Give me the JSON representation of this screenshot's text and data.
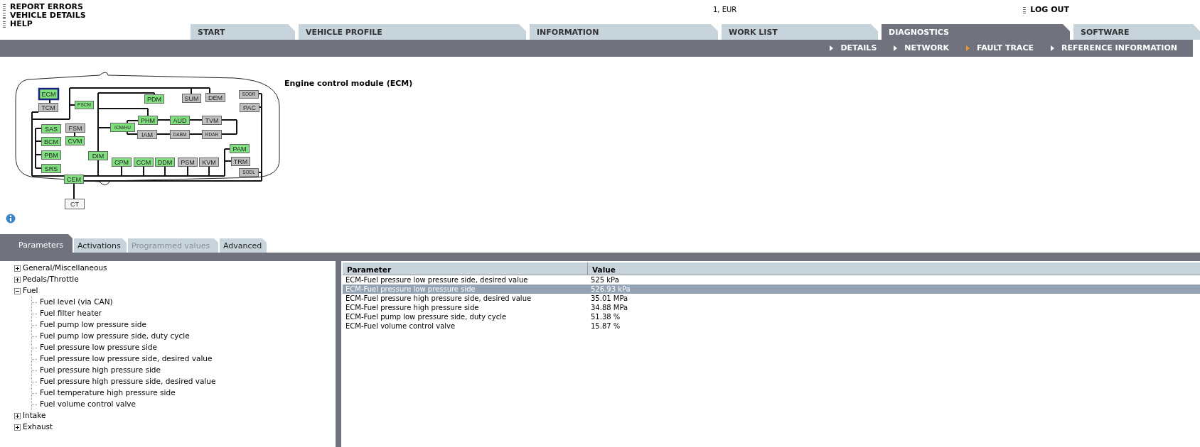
{
  "header_links": [
    {
      "label": "REPORT ERRORS"
    },
    {
      "label": "VEHICLE DETAILS"
    },
    {
      "label": "HELP"
    }
  ],
  "currency": "1, EUR",
  "logout": "LOG OUT",
  "tabs": [
    {
      "label": "START",
      "selected": false
    },
    {
      "label": "VEHICLE PROFILE",
      "selected": false
    },
    {
      "label": "INFORMATION",
      "selected": false
    },
    {
      "label": "WORK LIST",
      "selected": false
    },
    {
      "label": "DIAGNOSTICS",
      "selected": true
    },
    {
      "label": "SOFTWARE",
      "selected": false
    }
  ],
  "subnav": [
    {
      "label": "DETAILS",
      "selected": false
    },
    {
      "label": "NETWORK",
      "selected": false
    },
    {
      "label": "FAULT TRACE",
      "selected": true
    },
    {
      "label": "REFERENCE INFORMATION",
      "selected": false
    }
  ],
  "module_title": "Engine control module (ECM)",
  "network": {
    "modules": [
      {
        "label": "ECM",
        "color": "#80e080",
        "selected": true
      },
      {
        "label": "TCM",
        "color": "#c0c0c0",
        "selected": false
      },
      {
        "label": "PSCM",
        "color": "#80e080",
        "selected": false
      },
      {
        "label": "PDM",
        "color": "#80e080",
        "selected": false
      },
      {
        "label": "SUM",
        "color": "#c0c0c0",
        "selected": false
      },
      {
        "label": "DEM",
        "color": "#c0c0c0",
        "selected": false
      },
      {
        "label": "SODR",
        "color": "#c0c0c0",
        "selected": false
      },
      {
        "label": "PAC",
        "color": "#c0c0c0",
        "selected": false
      },
      {
        "label": "PHM",
        "color": "#80e080",
        "selected": false
      },
      {
        "label": "AUD",
        "color": "#80e080",
        "selected": false
      },
      {
        "label": "TVM",
        "color": "#c0c0c0",
        "selected": false
      },
      {
        "label": "ICM/HU",
        "color": "#80e080",
        "selected": false
      },
      {
        "label": "IAM",
        "color": "#c0c0c0",
        "selected": false
      },
      {
        "label": "DABM",
        "color": "#c0c0c0",
        "selected": false
      },
      {
        "label": "RDAR",
        "color": "#c0c0c0",
        "selected": false
      },
      {
        "label": "FSM",
        "color": "#c0c0c0",
        "selected": false
      },
      {
        "label": "CVM",
        "color": "#80e080",
        "selected": false
      },
      {
        "label": "SAS",
        "color": "#80e080",
        "selected": false
      },
      {
        "label": "BCM",
        "color": "#80e080",
        "selected": false
      },
      {
        "label": "PBM",
        "color": "#80e080",
        "selected": false
      },
      {
        "label": "SRS",
        "color": "#80e080",
        "selected": false
      },
      {
        "label": "DIM",
        "color": "#80e080",
        "selected": false
      },
      {
        "label": "CPM",
        "color": "#80e080",
        "selected": false
      },
      {
        "label": "CCM",
        "color": "#80e080",
        "selected": false
      },
      {
        "label": "DDM",
        "color": "#80e080",
        "selected": false
      },
      {
        "label": "PSM",
        "color": "#c0c0c0",
        "selected": false
      },
      {
        "label": "KVM",
        "color": "#c0c0c0",
        "selected": false
      },
      {
        "label": "PAM",
        "color": "#80e080",
        "selected": false
      },
      {
        "label": "TRM",
        "color": "#c0c0c0",
        "selected": false
      },
      {
        "label": "SODL",
        "color": "#c0c0c0",
        "selected": false
      },
      {
        "label": "CEM",
        "color": "#80e080",
        "selected": false
      },
      {
        "label": "CT",
        "color": "#f7f7f7",
        "selected": false
      }
    ]
  },
  "param_tabs": [
    {
      "label": "Parameters",
      "selected": true,
      "disabled": false
    },
    {
      "label": "Activations",
      "selected": false,
      "disabled": false
    },
    {
      "label": "Programmed values",
      "selected": false,
      "disabled": true
    },
    {
      "label": "Advanced",
      "selected": false,
      "disabled": false
    }
  ],
  "tree": [
    {
      "label": "General/Miscellaneous",
      "expanded": false
    },
    {
      "label": "Pedals/Throttle",
      "expanded": false
    },
    {
      "label": "Fuel",
      "expanded": true,
      "children": [
        {
          "label": "Fuel level (via CAN)"
        },
        {
          "label": "Fuel filter heater"
        },
        {
          "label": "Fuel pump low pressure side"
        },
        {
          "label": "Fuel pump low pressure side, duty cycle"
        },
        {
          "label": "Fuel pressure low pressure side"
        },
        {
          "label": "Fuel pressure low pressure side, desired value"
        },
        {
          "label": "Fuel pressure high pressure side"
        },
        {
          "label": "Fuel pressure high pressure side, desired value"
        },
        {
          "label": "Fuel temperature high pressure side"
        },
        {
          "label": "Fuel volume control valve"
        }
      ]
    },
    {
      "label": "Intake",
      "expanded": false
    },
    {
      "label": "Exhaust",
      "expanded": false
    }
  ],
  "table": {
    "columns": [
      "Parameter",
      "Value"
    ],
    "rows": [
      {
        "parameter": "ECM-Fuel pressure low pressure side, desired value",
        "value": "525 kPa",
        "selected": false
      },
      {
        "parameter": "ECM-Fuel pressure low pressure side",
        "value": "526.93 kPa",
        "selected": true
      },
      {
        "parameter": "ECM-Fuel pressure high pressure side, desired value",
        "value": "35.01 MPa",
        "selected": false
      },
      {
        "parameter": "ECM-Fuel pressure high pressure side",
        "value": "34.88 MPa",
        "selected": false
      },
      {
        "parameter": "ECM-Fuel pump low pressure side, duty cycle",
        "value": "51.38 %",
        "selected": false
      },
      {
        "parameter": "ECM-Fuel volume control valve",
        "value": "15.87 %",
        "selected": false
      }
    ]
  }
}
